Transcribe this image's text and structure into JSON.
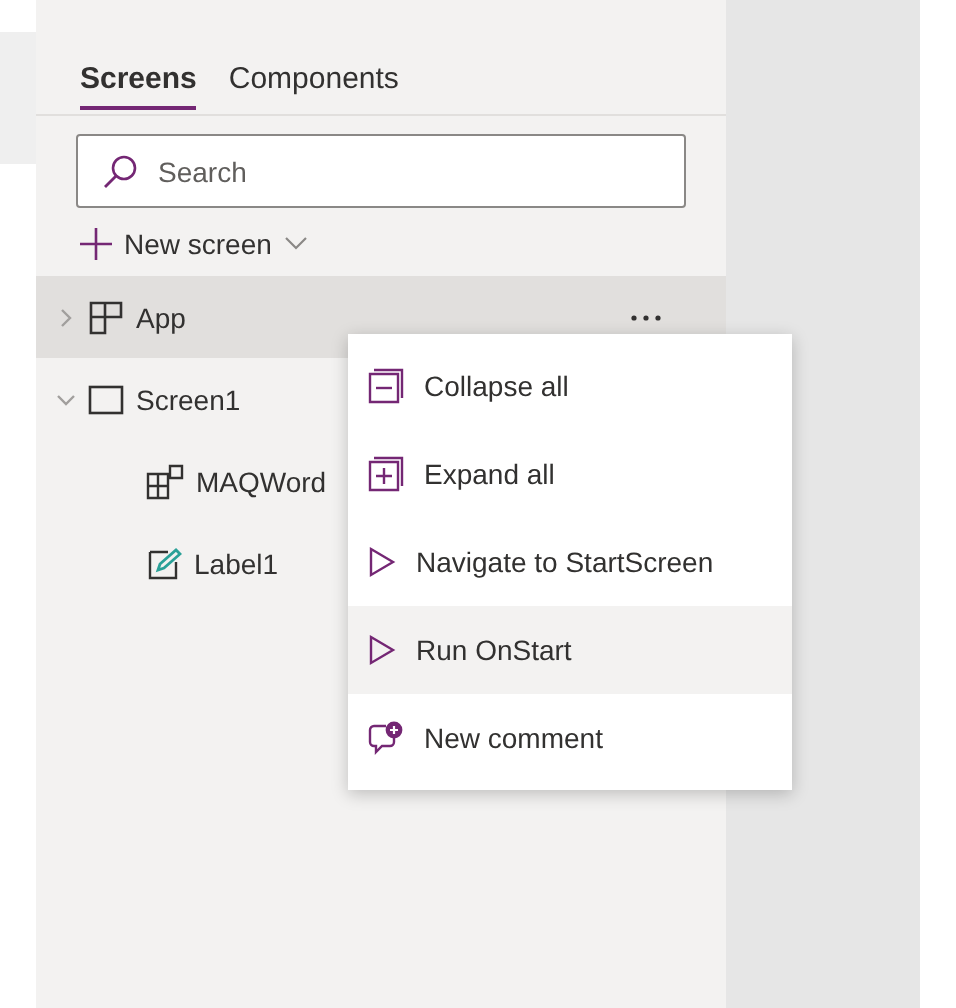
{
  "tabs": [
    {
      "label": "Screens",
      "selected": true
    },
    {
      "label": "Components",
      "selected": false
    }
  ],
  "search": {
    "placeholder": "Search"
  },
  "new_screen": {
    "label": "New screen"
  },
  "tree": [
    {
      "label": "App",
      "kind": "app",
      "expanded": false,
      "selected": true
    },
    {
      "label": "Screen1",
      "kind": "screen",
      "expanded": true,
      "selected": false,
      "children": [
        {
          "label": "MAQWord",
          "kind": "gallery",
          "selected": false
        },
        {
          "label": "Label1",
          "kind": "label",
          "selected": false
        }
      ]
    }
  ],
  "context_menu": {
    "items": [
      {
        "label": "Collapse all",
        "kind": "collapse",
        "selected": false
      },
      {
        "label": "Expand all",
        "kind": "expand",
        "selected": false
      },
      {
        "label": "Navigate to StartScreen",
        "kind": "play",
        "selected": false
      },
      {
        "label": "Run OnStart",
        "kind": "play",
        "selected": true
      },
      {
        "label": "New comment",
        "kind": "comment",
        "selected": false
      }
    ]
  }
}
